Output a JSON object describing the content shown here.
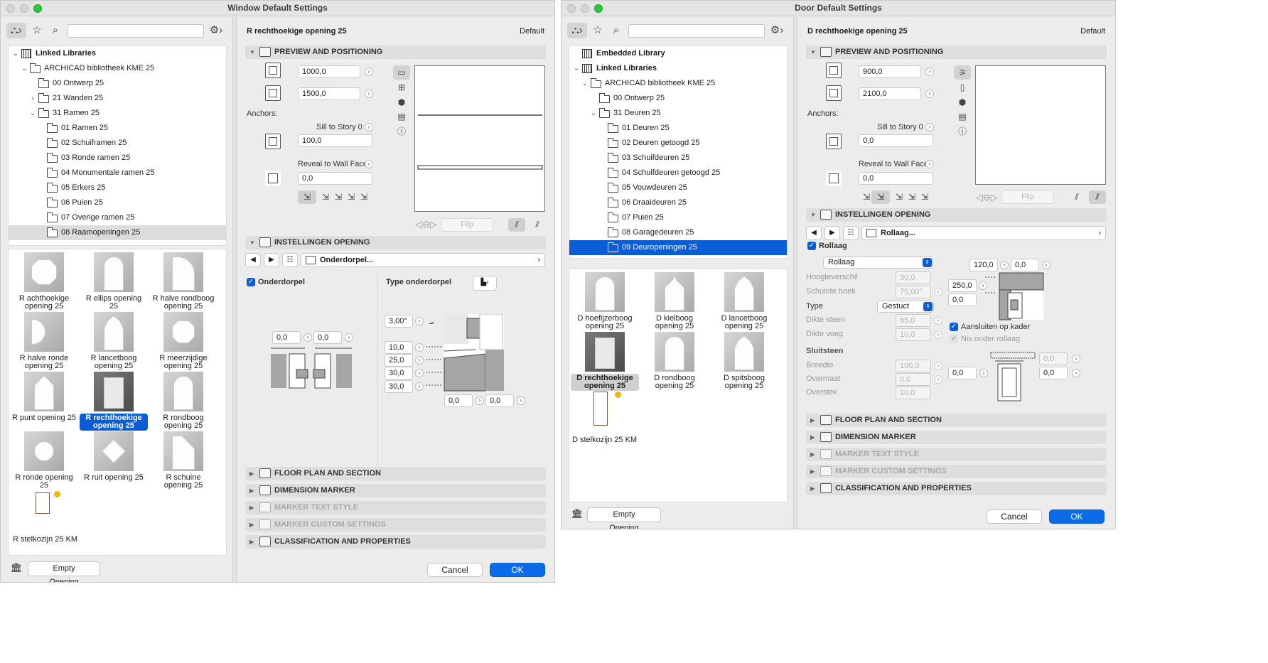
{
  "window": {
    "title": "Window Default Settings",
    "library": {
      "rows": [
        {
          "label": "Linked Libraries",
          "level": 0,
          "twist": "v",
          "icon": "lib",
          "bold": true,
          "sel": ""
        },
        {
          "label": "ARCHICAD bibliotheek KME 25",
          "level": 1,
          "twist": "v",
          "icon": "folder",
          "bold": false,
          "sel": ""
        },
        {
          "label": "00 Ontwerp 25",
          "level": 2,
          "twist": "",
          "icon": "folder",
          "bold": false,
          "sel": ""
        },
        {
          "label": "21 Wanden 25",
          "level": 2,
          "twist": ">",
          "icon": "folder",
          "bold": false,
          "sel": ""
        },
        {
          "label": "31 Ramen 25",
          "level": 2,
          "twist": "v",
          "icon": "folder",
          "bold": false,
          "sel": ""
        },
        {
          "label": "01 Ramen 25",
          "level": 3,
          "twist": "",
          "icon": "folder",
          "bold": false,
          "sel": ""
        },
        {
          "label": "02 Schuiframen 25",
          "level": 3,
          "twist": "",
          "icon": "folder",
          "bold": false,
          "sel": ""
        },
        {
          "label": "03 Ronde ramen 25",
          "level": 3,
          "twist": "",
          "icon": "folder",
          "bold": false,
          "sel": ""
        },
        {
          "label": "04 Monumentale ramen 25",
          "level": 3,
          "twist": "",
          "icon": "folder",
          "bold": false,
          "sel": ""
        },
        {
          "label": "05 Erkers 25",
          "level": 3,
          "twist": "",
          "icon": "folder",
          "bold": false,
          "sel": ""
        },
        {
          "label": "06 Puien 25",
          "level": 3,
          "twist": "",
          "icon": "folder",
          "bold": false,
          "sel": ""
        },
        {
          "label": "07 Overige ramen 25",
          "level": 3,
          "twist": "",
          "icon": "folder",
          "bold": false,
          "sel": ""
        },
        {
          "label": "08 Raamopeningen 25",
          "level": 3,
          "twist": "",
          "icon": "folder",
          "bold": false,
          "sel": "grey"
        }
      ],
      "objects": [
        {
          "label": "R achthoekige opening 25",
          "shape": "oct",
          "sel": ""
        },
        {
          "label": "R ellips opening 25",
          "shape": "ellipse",
          "sel": ""
        },
        {
          "label": "R halve rondboog opening 25",
          "shape": "halfarch",
          "sel": ""
        },
        {
          "label": "R halve ronde opening 25",
          "shape": "halfround",
          "sel": ""
        },
        {
          "label": "R lancetboog opening 25",
          "shape": "lancet",
          "sel": ""
        },
        {
          "label": "R meerzijdige opening 25",
          "shape": "poly",
          "sel": ""
        },
        {
          "label": "R punt opening 25",
          "shape": "point",
          "sel": ""
        },
        {
          "label": "R rechthoekige opening 25",
          "shape": "rect",
          "sel": "blue"
        },
        {
          "label": "R rondboog opening 25",
          "shape": "arch",
          "sel": ""
        },
        {
          "label": "R ronde opening 25",
          "shape": "circle",
          "sel": ""
        },
        {
          "label": "R ruit opening 25",
          "shape": "diamond",
          "sel": ""
        },
        {
          "label": "R schuine opening 25",
          "shape": "slant",
          "sel": ""
        }
      ],
      "kozijn_label": "R stelkozijn 25 KM",
      "empty_opening": "Empty Opening"
    },
    "header": {
      "name": "R rechthoekige opening 25",
      "default": "Default"
    },
    "preview": {
      "title": "PREVIEW AND POSITIONING",
      "width": "1000,0",
      "height": "1500,0",
      "anchors": "Anchors:",
      "sill_label": "Sill to Story 0",
      "sill_value": "100,0",
      "reveal_label": "Reveal to Wall Face",
      "reveal_value": "0,0",
      "flip": "Flip"
    },
    "instellingen": {
      "title": "INSTELLINGEN OPENING",
      "popup": "Onderdorpel...",
      "check_label": "Onderdorpel",
      "type_label": "Type onderdorpel",
      "left_a": "0,0",
      "left_b": "0,0",
      "angle": "3,00°",
      "v1": "10,0",
      "v2": "25,0",
      "v3": "30,0",
      "v4": "30,0",
      "b1": "0,0",
      "b2": "0,0"
    },
    "sections": [
      {
        "label": "FLOOR PLAN AND SECTION",
        "disabled": false
      },
      {
        "label": "DIMENSION MARKER",
        "disabled": false
      },
      {
        "label": "MARKER TEXT STYLE",
        "disabled": true
      },
      {
        "label": "MARKER CUSTOM SETTINGS",
        "disabled": true
      },
      {
        "label": "CLASSIFICATION AND PROPERTIES",
        "disabled": false
      }
    ],
    "cancel": "Cancel",
    "ok": "OK"
  },
  "door": {
    "title": "Door Default Settings",
    "library": {
      "rows": [
        {
          "label": "Embedded Library",
          "level": 0,
          "twist": "",
          "icon": "lib",
          "bold": true,
          "sel": ""
        },
        {
          "label": "Linked Libraries",
          "level": 0,
          "twist": "v",
          "icon": "lib",
          "bold": true,
          "sel": ""
        },
        {
          "label": "ARCHICAD bibliotheek KME 25",
          "level": 1,
          "twist": "v",
          "icon": "folder",
          "bold": false,
          "sel": ""
        },
        {
          "label": "00 Ontwerp 25",
          "level": 2,
          "twist": "",
          "icon": "folder",
          "bold": false,
          "sel": ""
        },
        {
          "label": "31 Deuren 25",
          "level": 2,
          "twist": "v",
          "icon": "folder",
          "bold": false,
          "sel": ""
        },
        {
          "label": "01 Deuren 25",
          "level": 3,
          "twist": "",
          "icon": "folder",
          "bold": false,
          "sel": ""
        },
        {
          "label": "02 Deuren getoogd 25",
          "level": 3,
          "twist": "",
          "icon": "folder",
          "bold": false,
          "sel": ""
        },
        {
          "label": "03 Schuifdeuren 25",
          "level": 3,
          "twist": "",
          "icon": "folder",
          "bold": false,
          "sel": ""
        },
        {
          "label": "04 Schuifdeuren getoogd 25",
          "level": 3,
          "twist": "",
          "icon": "folder",
          "bold": false,
          "sel": ""
        },
        {
          "label": "05 Vouwdeuren 25",
          "level": 3,
          "twist": "",
          "icon": "folder",
          "bold": false,
          "sel": ""
        },
        {
          "label": "06 Draaideuren 25",
          "level": 3,
          "twist": "",
          "icon": "folder",
          "bold": false,
          "sel": ""
        },
        {
          "label": "07 Puien 25",
          "level": 3,
          "twist": "",
          "icon": "folder",
          "bold": false,
          "sel": ""
        },
        {
          "label": "08 Garagedeuren 25",
          "level": 3,
          "twist": "",
          "icon": "folder",
          "bold": false,
          "sel": ""
        },
        {
          "label": "09 Deuropeningen 25",
          "level": 3,
          "twist": "",
          "icon": "folder",
          "bold": false,
          "sel": "blue"
        }
      ],
      "objects": [
        {
          "label": "D hoefijzerboog opening 25",
          "shape": "horseshoe",
          "sel": ""
        },
        {
          "label": "D kielboog opening 25",
          "shape": "ogee",
          "sel": ""
        },
        {
          "label": "D lancetboog opening 25",
          "shape": "lancet",
          "sel": ""
        },
        {
          "label": "D rechthoekige opening 25",
          "shape": "rect",
          "sel": "grey"
        },
        {
          "label": "D rondboog opening 25",
          "shape": "arch",
          "sel": ""
        },
        {
          "label": "D spitsboog opening 25",
          "shape": "lancet",
          "sel": ""
        }
      ],
      "kozijn_label": "D stelkozijn 25 KM",
      "empty_opening": "Empty Opening"
    },
    "header": {
      "name": "D rechthoekige opening 25",
      "default": "Default"
    },
    "preview": {
      "title": "PREVIEW AND POSITIONING",
      "width": "900,0",
      "height": "2100,0",
      "anchors": "Anchors:",
      "sill_label": "Sill to Story 0",
      "sill_value": "0,0",
      "reveal_label": "Reveal to Wall Face",
      "reveal_value": "0,0",
      "flip": "Flip"
    },
    "instellingen": {
      "title": "INSTELLINGEN OPENING",
      "popup": "Rollaag...",
      "check_label": "Rollaag",
      "select_value": "Rollaag",
      "hoogte_label": "Hoogteverschil",
      "hoogte_value": "30,0",
      "schuin_label": "Schuinte hoek",
      "schuin_value": "75,00°",
      "type_label": "Type",
      "type_value": "Gestuct",
      "dikte_steen_label": "Dikte steen",
      "dikte_steen_value": "65,0",
      "dikte_voeg_label": "Dikte voeg",
      "dikte_voeg_value": "10,0",
      "sluitsteen_label": "Sluitsteen",
      "breedte_label": "Breedte",
      "breedte_value": "100,0",
      "overmaat_label": "Overmaat",
      "overmaat_value": "0,0",
      "overstek_label": "Overstek",
      "overstek_value": "10,0",
      "r1": "120,0",
      "r2": "0,0",
      "r3": "250,0",
      "r4": "0,0",
      "aansluiten_label": "Aansluiten op kader",
      "nis_label": "Nis onder rollaag",
      "s1": "0,0",
      "s2": "0,0",
      "s3": "0,0"
    },
    "sections": [
      {
        "label": "FLOOR PLAN AND SECTION",
        "disabled": false
      },
      {
        "label": "DIMENSION MARKER",
        "disabled": false
      },
      {
        "label": "MARKER TEXT STYLE",
        "disabled": true
      },
      {
        "label": "MARKER CUSTOM SETTINGS",
        "disabled": true
      },
      {
        "label": "CLASSIFICATION AND PROPERTIES",
        "disabled": false
      }
    ],
    "cancel": "Cancel",
    "ok": "OK"
  }
}
